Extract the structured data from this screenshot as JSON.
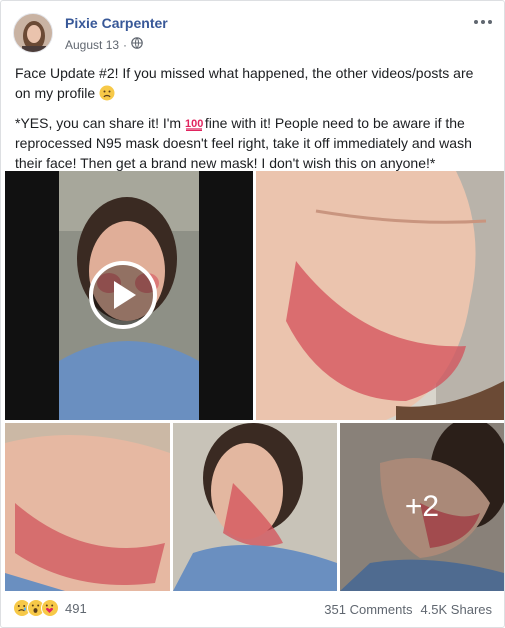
{
  "post": {
    "author": "Pixie Carpenter",
    "date": "August 13",
    "dot": "·",
    "privacy_icon": "globe-icon",
    "more_icon": "ellipsis-icon",
    "paragraph1": "Face Update #2! If you missed what happened, the other videos/posts are on my profile",
    "paragraph2_a": "*YES, you can share it! I'm",
    "paragraph2_b": "fine with it! People need to be aware if the reprocessed N95 mask doesn't feel right, take it off immediately and wash their face! Then get a brand new mask! I don't wish this on anyone!*",
    "emoji1": "worried-face-emoji",
    "emoji2": "hundred-points-emoji"
  },
  "media": {
    "more_count_label": "+2",
    "play_icon": "play-icon"
  },
  "footer": {
    "reaction_icons": [
      "sad-reaction-icon",
      "wow-reaction-icon",
      "care-reaction-icon"
    ],
    "reaction_count": "491",
    "comments": "351 Comments",
    "shares": "4.5K Shares"
  },
  "colors": {
    "link": "#385898",
    "muted": "#616770",
    "scrubs": "#6a8fc0",
    "skin": "#e3b7a0",
    "burn": "#d4505a"
  }
}
